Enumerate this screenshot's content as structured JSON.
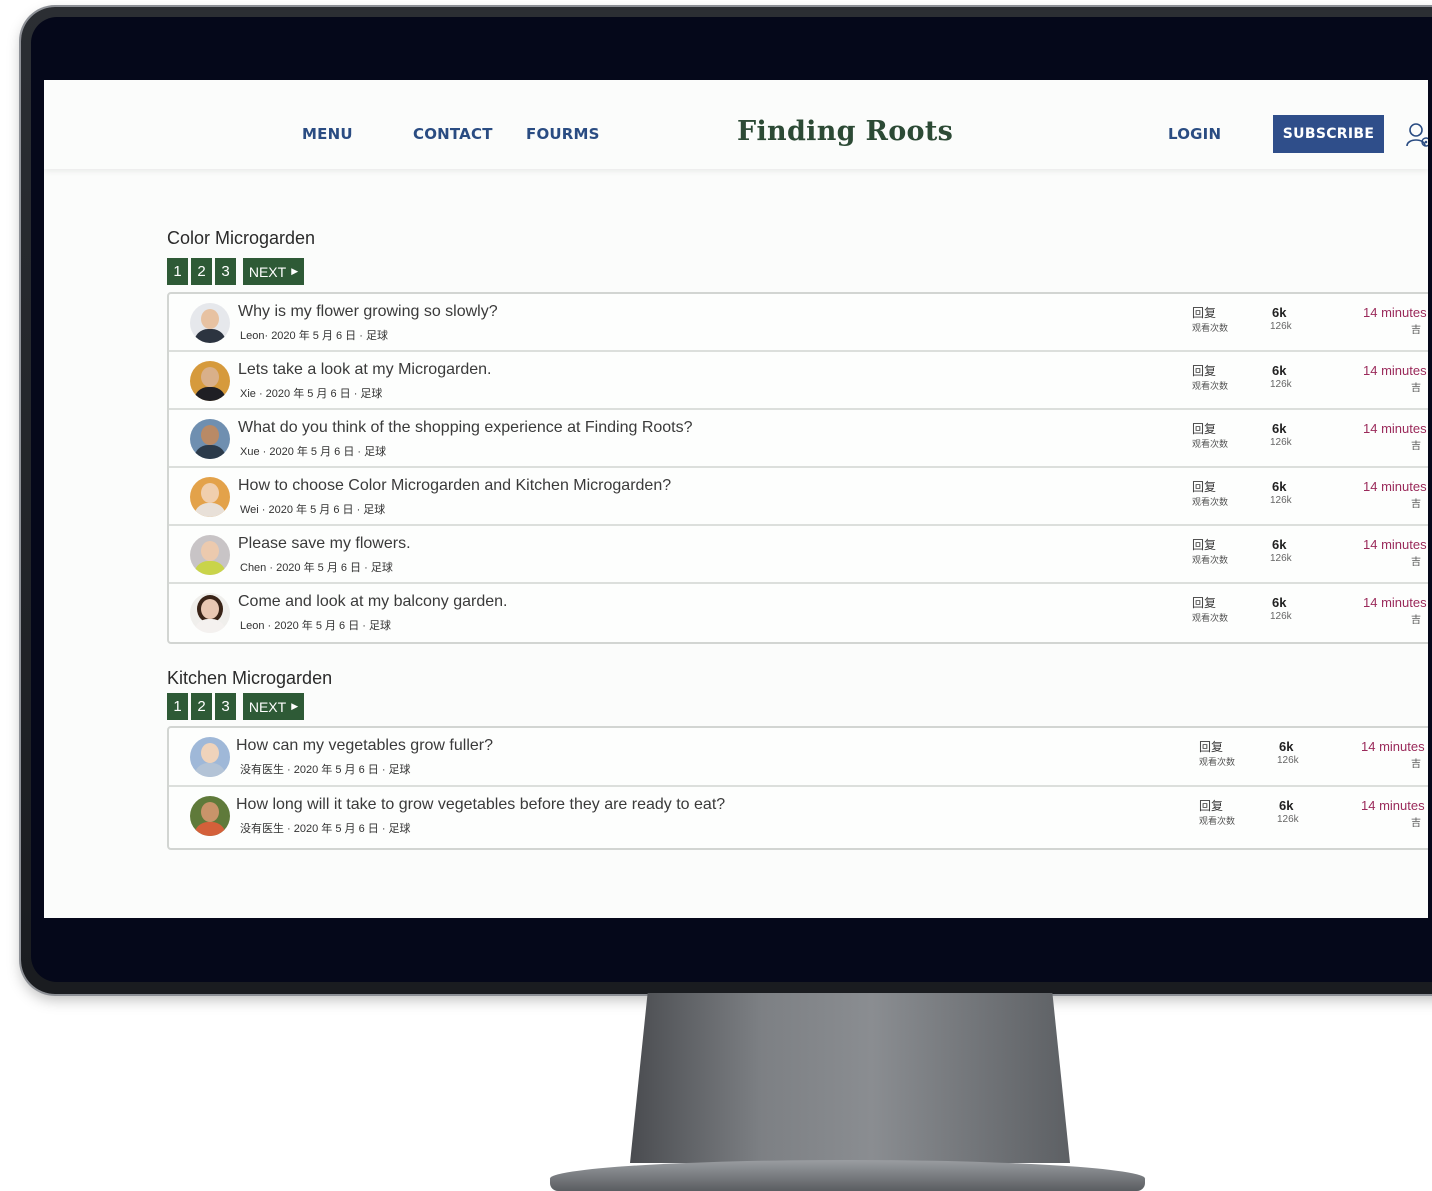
{
  "header": {
    "nav": [
      "MENU",
      "CONTACT",
      "FOURMS"
    ],
    "brand": "Finding Roots",
    "login": "LOGIN",
    "subscribe": "SUBSCRIBE"
  },
  "sections": [
    {
      "title": "Color Microgarden",
      "pages": [
        "1",
        "2",
        "3"
      ],
      "next": "NEXT",
      "topics": [
        {
          "title": "Why is my flower growing so slowly?",
          "meta": "Leon· 2020 年 5 月 6 日 · 足球",
          "stat_label": "回复",
          "stat_sublabel": "观看次数",
          "replies": "6k",
          "views": "126k",
          "time": "14 minutes",
          "time_sub": "吉"
        },
        {
          "title": "Lets take a look at my Microgarden.",
          "meta": "Xie · 2020 年 5 月 6 日 · 足球",
          "stat_label": "回复",
          "stat_sublabel": "观看次数",
          "replies": "6k",
          "views": "126k",
          "time": "14 minutes",
          "time_sub": "吉"
        },
        {
          "title": "What do you think of the shopping experience at Finding Roots?",
          "meta": "Xue · 2020 年 5 月 6 日 · 足球",
          "stat_label": "回复",
          "stat_sublabel": "观看次数",
          "replies": "6k",
          "views": "126k",
          "time": "14 minutes",
          "time_sub": "吉"
        },
        {
          "title": "How to choose Color Microgarden and Kitchen Microgarden?",
          "meta": "Wei · 2020 年 5 月 6 日 · 足球",
          "stat_label": "回复",
          "stat_sublabel": "观看次数",
          "replies": "6k",
          "views": "126k",
          "time": "14 minutes",
          "time_sub": "吉"
        },
        {
          "title": "Please save my flowers.",
          "meta": "Chen · 2020 年 5 月 6 日 · 足球",
          "stat_label": "回复",
          "stat_sublabel": "观看次数",
          "replies": "6k",
          "views": "126k",
          "time": "14 minutes",
          "time_sub": "吉"
        },
        {
          "title": "Come and look at my balcony garden.",
          "meta": "Leon · 2020 年 5 月 6 日 · 足球",
          "stat_label": "回复",
          "stat_sublabel": "观看次数",
          "replies": "6k",
          "views": "126k",
          "time": "14 minutes",
          "time_sub": "吉"
        }
      ]
    },
    {
      "title": "Kitchen Microgarden",
      "pages": [
        "1",
        "2",
        "3"
      ],
      "next": "NEXT",
      "topics": [
        {
          "title": "How can my vegetables grow fuller?",
          "meta": "没有医生 · 2020 年 5 月 6 日 · 足球",
          "stat_label": "回复",
          "stat_sublabel": "观看次数",
          "replies": "6k",
          "views": "126k",
          "time": "14 minutes",
          "time_sub": "吉"
        },
        {
          "title": "How long will it take to grow vegetables before they are ready to eat?",
          "meta": "没有医生 · 2020 年 5 月 6 日 · 足球",
          "stat_label": "回复",
          "stat_sublabel": "观看次数",
          "replies": "6k",
          "views": "126k",
          "time": "14 minutes",
          "time_sub": "吉"
        }
      ]
    }
  ]
}
